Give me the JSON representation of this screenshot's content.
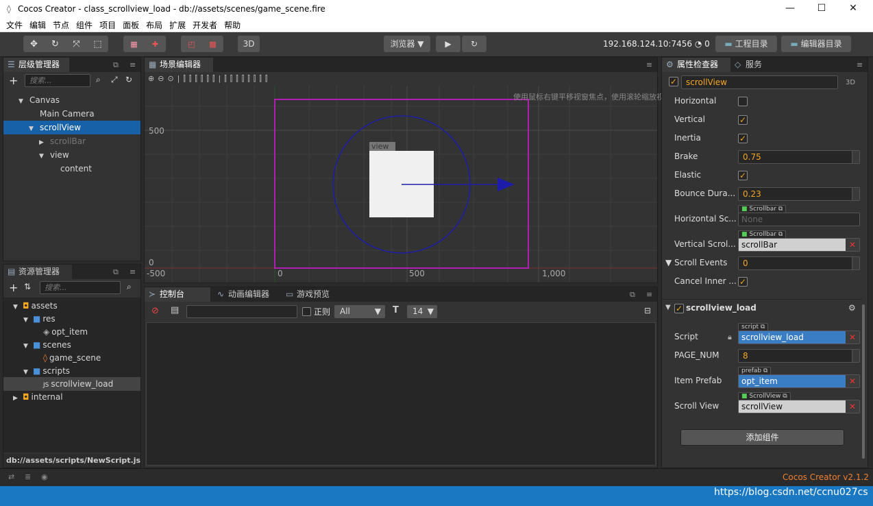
{
  "window": {
    "title": "Cocos Creator - class_scrollview_load - db://assets/scenes/game_scene.fire"
  },
  "menu": [
    "文件",
    "编辑",
    "节点",
    "组件",
    "项目",
    "面板",
    "布局",
    "扩展",
    "开发者",
    "帮助"
  ],
  "toolbar": {
    "mode3d": "3D",
    "browser": "浏览器",
    "ip": "192.168.124.10:7456",
    "devices": "0",
    "project_dir": "工程目录",
    "editor_dir": "编辑器目录"
  },
  "hierarchy": {
    "tab": "层级管理器",
    "search_placeholder": "搜索...",
    "nodes": [
      {
        "label": "Canvas",
        "indent": 0,
        "arrow": "▼"
      },
      {
        "label": "Main Camera",
        "indent": 1,
        "arrow": ""
      },
      {
        "label": "scrollView",
        "indent": 1,
        "arrow": "▼",
        "selected": true
      },
      {
        "label": "scrollBar",
        "indent": 2,
        "arrow": "▶",
        "dim": true
      },
      {
        "label": "view",
        "indent": 2,
        "arrow": "▼"
      },
      {
        "label": "content",
        "indent": 3,
        "arrow": ""
      }
    ]
  },
  "assets": {
    "tab": "资源管理器",
    "search_placeholder": "搜索...",
    "items": [
      {
        "label": "assets",
        "indent": 0,
        "icon": "db"
      },
      {
        "label": "res",
        "indent": 1,
        "icon": "folder"
      },
      {
        "label": "opt_item",
        "indent": 2,
        "icon": "prefab"
      },
      {
        "label": "scenes",
        "indent": 1,
        "icon": "folder"
      },
      {
        "label": "game_scene",
        "indent": 2,
        "icon": "fire"
      },
      {
        "label": "scripts",
        "indent": 1,
        "icon": "folder"
      },
      {
        "label": "scrollview_load",
        "indent": 2,
        "icon": "js",
        "selected": true
      },
      {
        "label": "internal",
        "indent": 0,
        "icon": "db",
        "collapsed": true
      }
    ],
    "status_path": "db://assets/scripts/NewScript.js"
  },
  "scene": {
    "tab": "场景编辑器",
    "hint": "使用鼠标右键平移视窗焦点，使用滚轮缩放视图",
    "view_label": "view",
    "axis": {
      "y500": "500",
      "y0": "0",
      "xm500": "-500",
      "x0": "0",
      "x500": "500",
      "x1000": "1,000"
    }
  },
  "console": {
    "tabs": [
      "控制台",
      "动画编辑器",
      "游戏预览"
    ],
    "regex_label": "正则",
    "filter": "All",
    "font_size": "14"
  },
  "inspector": {
    "tabs": [
      "属性检查器",
      "服务"
    ],
    "node_name": "scrollView",
    "mode3d": "3D",
    "props": {
      "horizontal": "Horizontal",
      "vertical": "Vertical",
      "inertia": "Inertia",
      "brake": "Brake",
      "brake_val": "0.75",
      "elastic": "Elastic",
      "bounce": "Bounce Dura...",
      "bounce_val": "0.23",
      "hscroll": "Horizontal Sc...",
      "hscroll_tag": "Scrollbar",
      "hscroll_val": "None",
      "vscroll": "Vertical Scrol...",
      "vscroll_tag": "Scrollbar",
      "vscroll_val": "scrollBar",
      "events": "Scroll Events",
      "events_val": "0",
      "cancel": "Cancel Inner ..."
    },
    "component": {
      "name": "scrollview_load",
      "script": "Script",
      "script_tag": "script",
      "script_val": "scrollview_load",
      "page": "PAGE_NUM",
      "page_val": "8",
      "prefab": "Item Prefab",
      "prefab_tag": "prefab",
      "prefab_val": "opt_item",
      "sv": "Scroll View",
      "sv_tag": "ScrollView",
      "sv_val": "scrollView"
    },
    "add_component": "添加组件"
  },
  "footer": {
    "version": "Cocos Creator v2.1.2",
    "watermark": "https://blog.csdn.net/ccnu027cs"
  }
}
